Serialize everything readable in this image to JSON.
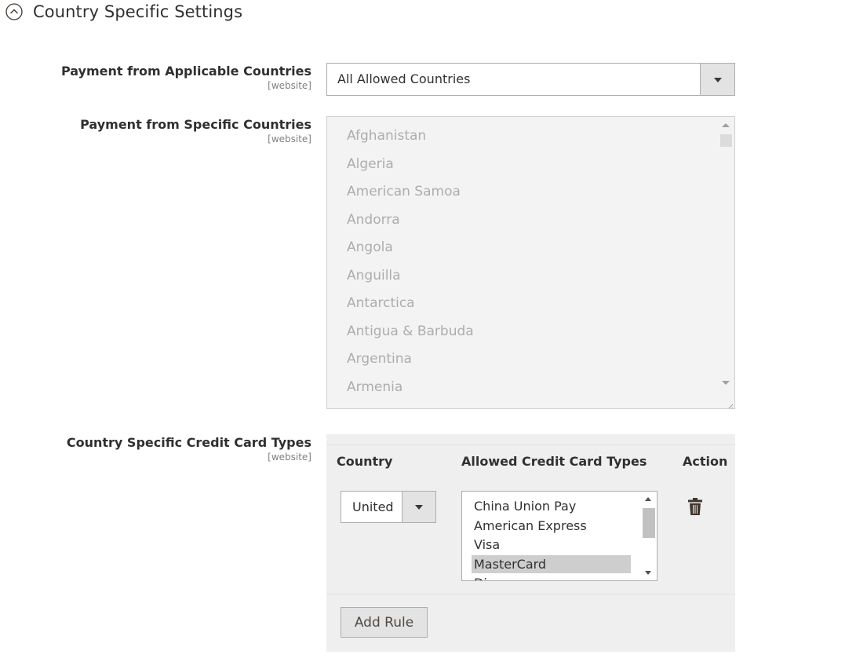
{
  "section": {
    "title": "Country Specific Settings",
    "icon": "chevron-up-circle-icon"
  },
  "applicable_countries": {
    "label": "Payment from Applicable Countries",
    "scope": "[website]",
    "value": "All Allowed Countries"
  },
  "specific_countries": {
    "label": "Payment from Specific Countries",
    "scope": "[website]",
    "options": [
      "Afghanistan",
      "Algeria",
      "American Samoa",
      "Andorra",
      "Angola",
      "Anguilla",
      "Antarctica",
      "Antigua & Barbuda",
      "Argentina",
      "Armenia"
    ]
  },
  "cc_types": {
    "label": "Country Specific Credit Card Types",
    "scope": "[website]",
    "headers": {
      "country": "Country",
      "allowed": "Allowed Credit Card Types",
      "action": "Action"
    },
    "row": {
      "country_value": "United",
      "card_options": [
        "China Union Pay",
        "American Express",
        "Visa",
        "MasterCard",
        "Di"
      ],
      "selected": "MasterCard"
    },
    "add_rule_label": "Add Rule"
  }
}
